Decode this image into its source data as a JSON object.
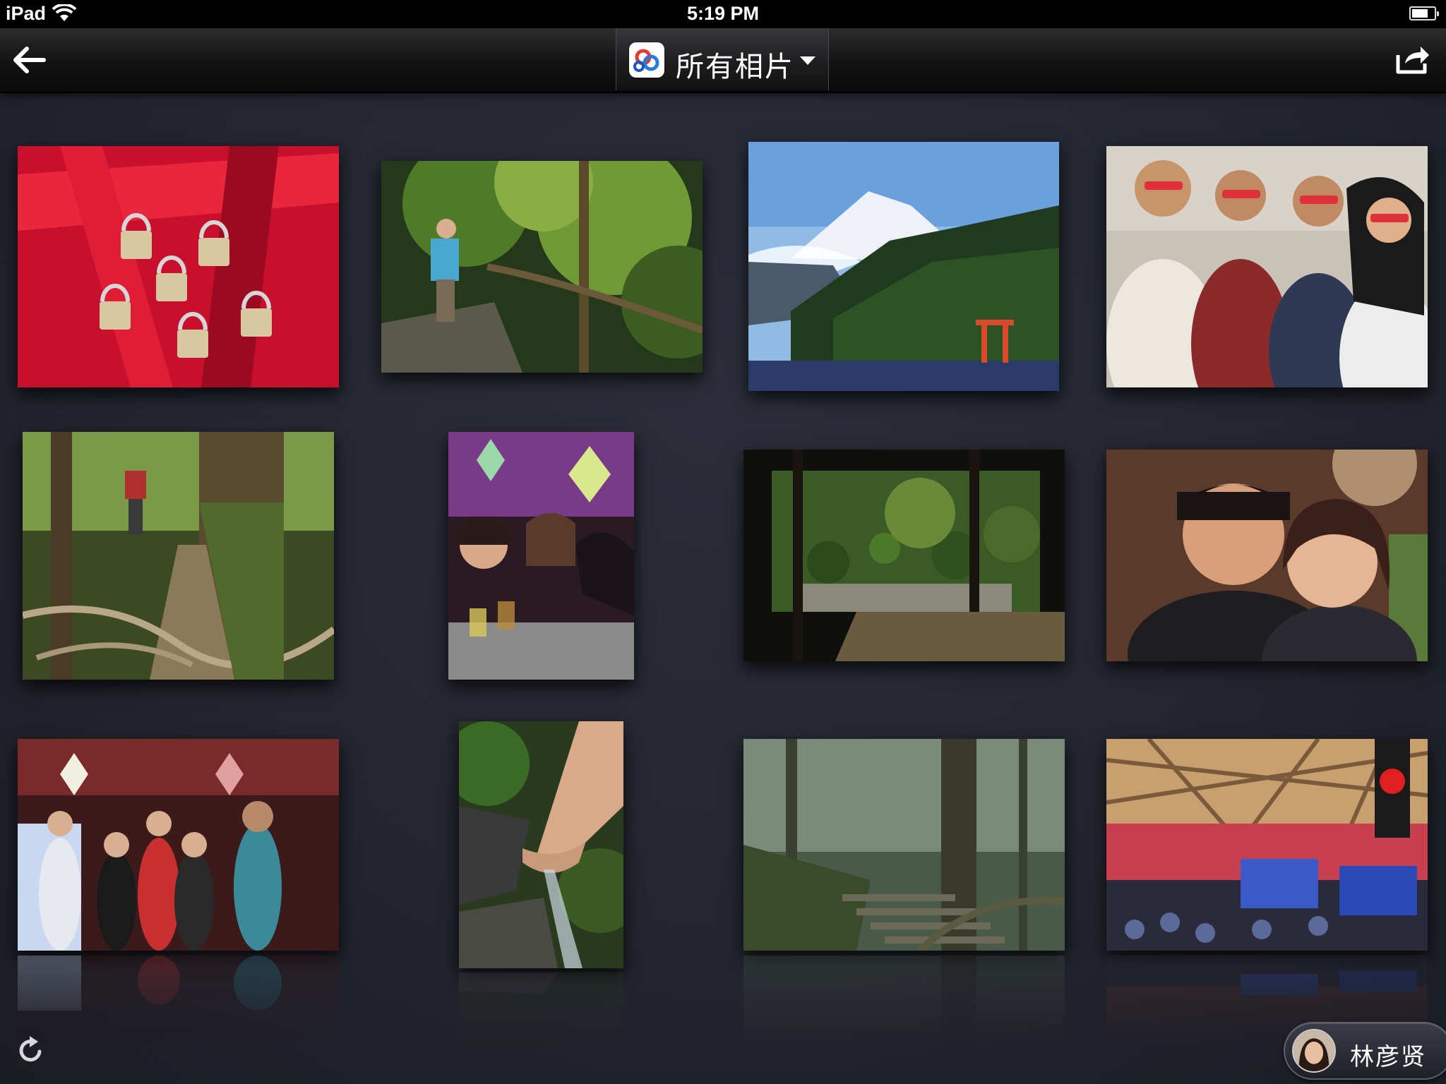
{
  "status_bar": {
    "device": "iPad",
    "time": "5:19 PM"
  },
  "nav_bar": {
    "album_title": "所有相片",
    "back_icon": "back-arrow-icon",
    "share_icon": "share-icon",
    "dropdown_icon": "chevron-down-icon"
  },
  "photos": [
    {
      "name": "photo-red-ribbon-locks",
      "colors": [
        "#c8102e",
        "#e0213a"
      ]
    },
    {
      "name": "photo-forest-hiker",
      "colors": [
        "#2f4a1d",
        "#7c9a3a"
      ]
    },
    {
      "name": "photo-mount-fuji-lake",
      "colors": [
        "#9cc2e6",
        "#2b4a2a"
      ]
    },
    {
      "name": "photo-friends-group",
      "colors": [
        "#b8b2a8",
        "#3a3a44"
      ]
    },
    {
      "name": "photo-forest-trail-roots",
      "colors": [
        "#4a5a2a",
        "#7a7055"
      ]
    },
    {
      "name": "photo-party-friends",
      "colors": [
        "#6a3a5a",
        "#2a2020"
      ]
    },
    {
      "name": "photo-japanese-garden",
      "colors": [
        "#2a3a1a",
        "#6a8a3a"
      ]
    },
    {
      "name": "photo-couple-portrait",
      "colors": [
        "#6a4a3a",
        "#c8a080"
      ]
    },
    {
      "name": "photo-dance-party",
      "colors": [
        "#5a2a2a",
        "#c87060"
      ]
    },
    {
      "name": "photo-water-hands",
      "colors": [
        "#3a4a2a",
        "#c8a88a"
      ]
    },
    {
      "name": "photo-misty-forest-stairs",
      "colors": [
        "#4a5a4a",
        "#7a8a70"
      ]
    },
    {
      "name": "photo-stadium-subway",
      "colors": [
        "#a04040",
        "#2a2a5a"
      ]
    }
  ],
  "bottom_bar": {
    "refresh_icon": "refresh-icon",
    "user_name": "林彦贤"
  }
}
